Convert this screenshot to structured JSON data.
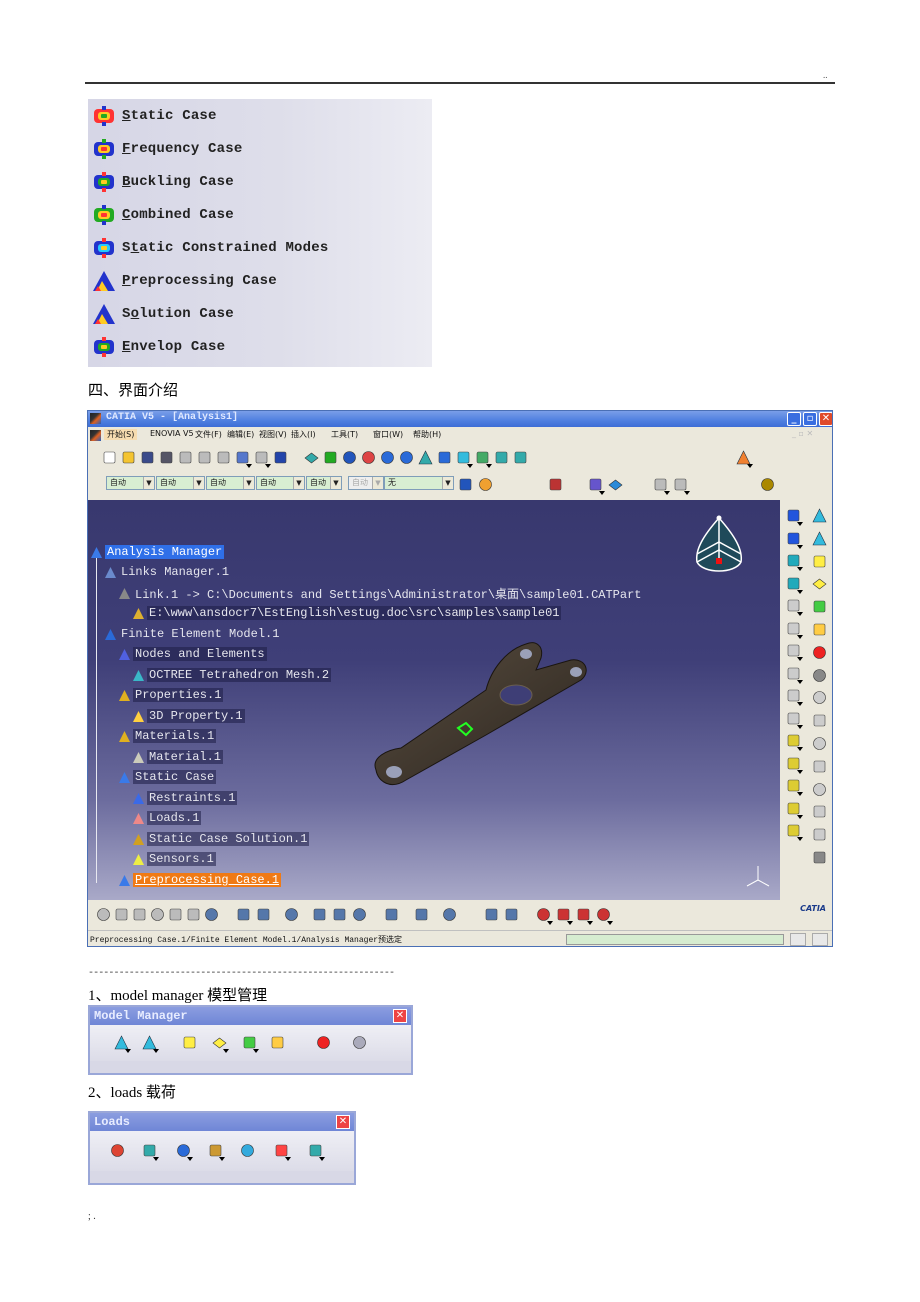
{
  "page": {
    "header_marker": "..",
    "footer_marker": "; .",
    "section_heading": "四、界面介绍",
    "dash_separator": "------------------------------------------------------------",
    "item1_heading": "1、model manager 模型管理",
    "item2_heading": "2、loads  载荷"
  },
  "case_menu": {
    "items": [
      {
        "icon": "static-case-icon",
        "pre": "",
        "mnemonic": "S",
        "post": "tatic Case"
      },
      {
        "icon": "frequency-case-icon",
        "pre": "",
        "mnemonic": "F",
        "post": "requency Case"
      },
      {
        "icon": "buckling-case-icon",
        "pre": "",
        "mnemonic": "B",
        "post": "uckling Case"
      },
      {
        "icon": "combined-case-icon",
        "pre": "",
        "mnemonic": "C",
        "post": "ombined Case"
      },
      {
        "icon": "static-constrained-modes-icon",
        "pre": "S",
        "mnemonic": "t",
        "post": "atic Constrained Modes"
      },
      {
        "icon": "preprocessing-case-icon",
        "pre": "",
        "mnemonic": "P",
        "post": "reprocessing Case"
      },
      {
        "icon": "solution-case-icon",
        "pre": "S",
        "mnemonic": "o",
        "post": "lution Case"
      },
      {
        "icon": "envelop-case-icon",
        "pre": "",
        "mnemonic": "E",
        "post": "nvelop Case"
      }
    ]
  },
  "catia": {
    "title": "CATIA V5 - [Analysis1]",
    "menu": [
      "开始(S)",
      "ENOVIA V5",
      "文件(F)",
      "编辑(E)",
      "视图(V)",
      "插入(I)",
      "工具(T)",
      "窗口(W)",
      "帮助(H)"
    ],
    "combos": [
      "自动",
      "自动",
      "自动",
      "自动",
      "自动",
      "自动",
      "无"
    ],
    "tree": [
      {
        "label": "Analysis Manager",
        "state": "selected"
      },
      {
        "label": "Links Manager.1",
        "state": "plain"
      },
      {
        "label": "Link.1 -> C:\\Documents and Settings\\Administrator\\桌面\\sample01.CATPart",
        "state": "plain"
      },
      {
        "label": "E:\\www\\ansdocr7\\EstEnglish\\estug.doc\\src\\samples\\sample01",
        "state": "normal"
      },
      {
        "label": "Finite Element Model.1",
        "state": "plain"
      },
      {
        "label": "Nodes and Elements",
        "state": "normal"
      },
      {
        "label": "OCTREE Tetrahedron Mesh.2",
        "state": "normal"
      },
      {
        "label": "Properties.1",
        "state": "normal"
      },
      {
        "label": "3D Property.1",
        "state": "normal"
      },
      {
        "label": "Materials.1",
        "state": "normal"
      },
      {
        "label": "Material.1",
        "state": "normal"
      },
      {
        "label": "Static Case",
        "state": "normal"
      },
      {
        "label": "Restraints.1",
        "state": "normal"
      },
      {
        "label": "Loads.1",
        "state": "normal"
      },
      {
        "label": "Static Case Solution.1",
        "state": "normal"
      },
      {
        "label": "Sensors.1",
        "state": "normal"
      },
      {
        "label": "Preprocessing Case.1",
        "state": "highlighted"
      }
    ],
    "status_text": "Preprocessing Case.1/Finite Element Model.1/Analysis Manager预选定",
    "brand": "CATIA",
    "colors": {
      "selection": "#2f6fe8",
      "highlight": "#f07a14",
      "titlebar": "#4f7fe0"
    }
  },
  "model_manager": {
    "title": "Model Manager",
    "icons": [
      "octree-tetrahedron-mesher-icon",
      "octree-triangle-mesher-icon",
      "3d-property-icon",
      "2d-property-icon",
      "beam-property-icon",
      "imported-property-icon",
      "model-checker-icon",
      "user-material-icon"
    ]
  },
  "loads_toolbar": {
    "title": "Loads",
    "icons": [
      "pressure-icon",
      "distributed-force-icon",
      "moment-icon",
      "line-force-icon",
      "enforced-displacement-icon",
      "temperature-field-icon",
      "combined-load-icon"
    ]
  }
}
